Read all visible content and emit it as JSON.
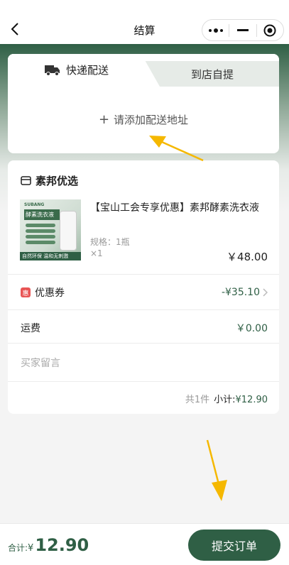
{
  "nav": {
    "title": "结算",
    "back_icon": "chevron-left-icon",
    "menu_icon": "more-dots-icon",
    "minimize_icon": "minimize-icon",
    "close_icon": "target-close-icon"
  },
  "delivery": {
    "tabs": [
      {
        "label": "快递配送",
        "icon": "truck-icon",
        "active": true
      },
      {
        "label": "到店自提",
        "active": false
      }
    ],
    "add_address_label": "请添加配送地址"
  },
  "order": {
    "store_name": "素邦优选",
    "store_icon": "store-icon",
    "product": {
      "name": "【宝山工会专享优惠】素邦酵素洗衣液",
      "image_brand": "SUBANG",
      "image_title": "酵素洗衣液",
      "image_footer": "自然环保 温和无刺激",
      "spec": "规格：1瓶",
      "quantity": "×1",
      "price": "￥48.00"
    },
    "coupon": {
      "badge": "惠",
      "label": "优惠券",
      "value": "-¥35.10"
    },
    "shipping": {
      "label": "运费",
      "value": "￥0.00"
    },
    "message_placeholder": "买家留言",
    "summary": {
      "count_text": "共1件",
      "subtotal_label": "小计:",
      "subtotal_value": "¥12.90"
    }
  },
  "footer": {
    "total_label": "合计:",
    "currency": "¥",
    "total_amount": "12.90",
    "submit_label": "提交订单"
  },
  "colors": {
    "primary": "#2f5f45",
    "coupon_badge": "#e85454",
    "annotation_arrow": "#f5b800"
  }
}
